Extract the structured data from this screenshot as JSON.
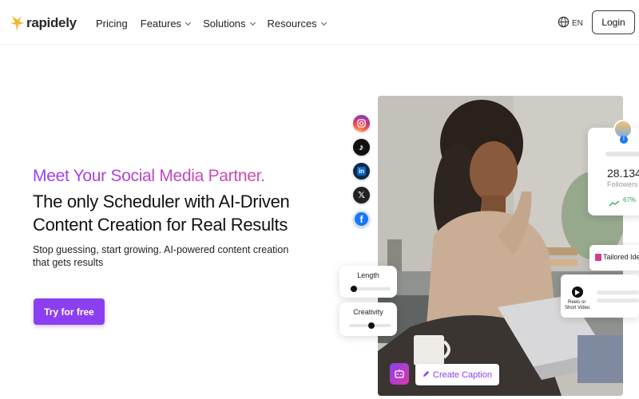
{
  "brand": {
    "name": "rapidely",
    "accent": "#8b3ff0",
    "star_color": "#f2b52b"
  },
  "nav": {
    "items": [
      {
        "label": "Pricing",
        "has_dropdown": false
      },
      {
        "label": "Features",
        "has_dropdown": true
      },
      {
        "label": "Solutions",
        "has_dropdown": true
      },
      {
        "label": "Resources",
        "has_dropdown": true
      }
    ],
    "language": "EN",
    "login_label": "Login"
  },
  "hero": {
    "tagline": "Meet Your Social Media Partner.",
    "headline": "The only Scheduler with AI-Driven Content Creation for Real Results",
    "subtext": "Stop guessing, start growing. AI-powered content creation that gets results",
    "cta_label": "Try for free"
  },
  "social_icons": [
    {
      "name": "instagram-icon",
      "glyph": "◎",
      "color": "#e1306c"
    },
    {
      "name": "tiktok-icon",
      "glyph": "♪",
      "color": "#111111"
    },
    {
      "name": "linkedin-icon",
      "glyph": "in",
      "color": "#0a66c2"
    },
    {
      "name": "x-icon",
      "glyph": "𝕏",
      "color": "#222222"
    },
    {
      "name": "facebook-icon",
      "glyph": "f",
      "color": "#1877f2"
    }
  ],
  "controls": {
    "length_label": "Length",
    "length_value": 0.05,
    "creativity_label": "Creativity",
    "creativity_value": 0.55
  },
  "stats_card": {
    "followers_value": "28.134",
    "followers_label": "Followers",
    "growth": "67%",
    "growth_color": "#2fa84f"
  },
  "tailored_card": {
    "label": "Tailored Ide"
  },
  "video_card": {
    "label_line1": "Reels or",
    "label_line2": "Short Video"
  },
  "caption_button": {
    "label": "Create Caption"
  }
}
